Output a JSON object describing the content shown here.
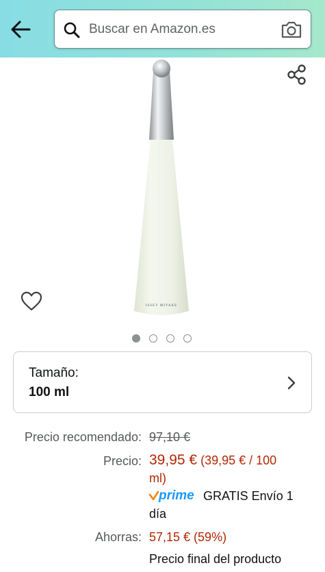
{
  "header": {
    "search": {
      "placeholder": "Buscar en Amazon.es"
    }
  },
  "icons": {
    "back": "arrow-left",
    "search": "magnifier",
    "camera": "camera",
    "share": "share",
    "wishlist": "heart-outline",
    "chevron": "chevron-right"
  },
  "product": {
    "brand_mark": "ISSEY MIYAKE",
    "carousel": {
      "count": 4,
      "active": 1
    }
  },
  "size": {
    "label": "Tamaño:",
    "value": "100 ml"
  },
  "pricing": {
    "list_label": "Precio recomendado:",
    "list_price": "97,10 €",
    "price_label": "Precio:",
    "price": "39,95 €",
    "unit_price_line1": "(39,95 € / 100",
    "unit_price_line2": "ml)",
    "prime_label": "prime",
    "shipping_line1": "GRATIS Envío 1",
    "shipping_line2": "día",
    "savings_label": "Ahorras:",
    "savings": "57,15 € (59%)",
    "final_note": "Precio final del producto"
  },
  "colors": {
    "price": "#b12704",
    "prime_blue": "#1a98ff",
    "prime_check": "#f08804",
    "header_gradient_start": "#88dde4",
    "header_gradient_end": "#a5e8cc"
  }
}
